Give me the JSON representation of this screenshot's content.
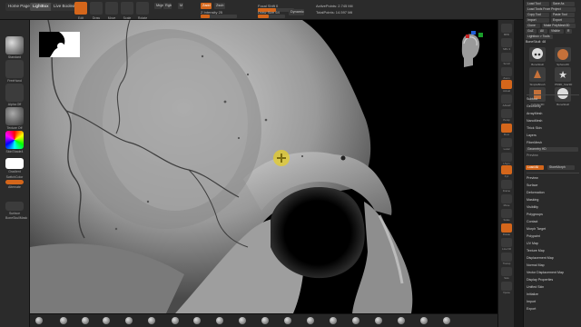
{
  "colors": {
    "accent": "#d4661b",
    "panel": "#2b2b2b",
    "viewport_bg": "#000000",
    "cursor": "#e6cd28"
  },
  "top_bar": {
    "tabs": [
      "Home Page",
      "LightBox",
      "Live Boolean"
    ],
    "tools": [
      {
        "label": "Edit",
        "icon": "edit-icon",
        "active": true
      },
      {
        "label": "Draw",
        "icon": "draw-icon"
      },
      {
        "label": "Move",
        "icon": "move-icon"
      },
      {
        "label": "Scale",
        "icon": "scale-icon"
      },
      {
        "label": "Rotate",
        "icon": "rotate-icon"
      }
    ],
    "brush_mode": {
      "mrgb": "Mrgb",
      "rgb": "Rgb",
      "m": "M"
    },
    "zadd": "Zadd",
    "zsub": "Zsub",
    "z_intensity": {
      "label": "Z Intensity",
      "value": 25
    },
    "focal_shift": {
      "label": "Focal Shift",
      "value": 0
    },
    "draw_size": {
      "label": "Draw Size",
      "value": 64
    },
    "dynamic": "Dynamic",
    "active_points": "ActivePoints: 2.745 Mil",
    "total_points": "TotalPoints: 14.597 Mil"
  },
  "left_shelf": {
    "items": [
      {
        "label": "Standard",
        "icon": "standard-brush-icon"
      },
      {
        "label": "FreeHand",
        "icon": "freehand-stroke-icon"
      },
      {
        "label": "Alpha Off",
        "icon": "alpha-off-icon"
      },
      {
        "label": "Texture Off",
        "icon": "texture-off-icon"
      },
      {
        "label": "SkinShade4",
        "icon": "material-sphere-icon"
      },
      {
        "label": "Gradient",
        "icon": "gradient-icon"
      },
      {
        "label": "SwitchColor",
        "icon": "switch-color-icon"
      },
      {
        "label": "Alternate",
        "icon": "alternate-icon"
      }
    ],
    "bottom_labels": [
      "Surface",
      "BoneSkullMask"
    ]
  },
  "right_strip": {
    "buttons": [
      {
        "label": "BPR",
        "icon": "bpr-icon"
      },
      {
        "label": "SPix 3",
        "icon": "spix-icon"
      },
      {
        "label": "Scroll",
        "icon": "scroll-icon"
      },
      {
        "label": "Zoom",
        "icon": "zoom-icon"
      },
      {
        "label": "Actual",
        "icon": "actual-icon"
      },
      {
        "label": "AAHalf",
        "icon": "aahalf-icon"
      },
      {
        "label": "Persp",
        "icon": "persp-icon",
        "active": true
      },
      {
        "label": "Floor",
        "icon": "floor-icon"
      },
      {
        "label": "Local",
        "icon": "local-icon"
      },
      {
        "label": "LSym",
        "icon": "lsym-icon"
      },
      {
        "label": "Xyz",
        "icon": "xyz-icon",
        "active": true
      },
      {
        "label": "Frame",
        "icon": "frame-icon"
      },
      {
        "label": "Move",
        "icon": "move-icon"
      },
      {
        "label": "Scale",
        "icon": "scale-icon"
      },
      {
        "label": "Rotate",
        "icon": "rotate-icon"
      },
      {
        "label": "Line Fill",
        "icon": "linefill-icon"
      },
      {
        "label": "Transp",
        "icon": "transp-icon"
      },
      {
        "label": "Solo",
        "icon": "solo-icon"
      },
      {
        "label": "Xpose",
        "icon": "xpose-icon"
      }
    ]
  },
  "tool_palette": {
    "top_buttons": [
      [
        "Load Tool",
        "Save As"
      ],
      [
        "Load Tools From Project"
      ],
      [
        "Copy Tool",
        "Paste Tool"
      ],
      [
        "Import",
        "Export"
      ],
      [
        "Clone",
        "Make PolyMesh3D"
      ],
      [
        "GoZ",
        "All",
        "Visible",
        "R"
      ],
      [
        "Lightbox > Tools"
      ]
    ],
    "current_tool": "BoneSkull: 48",
    "thumbnails": [
      {
        "label": "BoneSkull",
        "icon": "skull-thumb-icon"
      },
      {
        "label": "Sphere3D",
        "icon": "sphere-thumb-icon"
      },
      {
        "label": "SimpleBrush",
        "icon": "simplebrush-thumb-icon"
      },
      {
        "label": "PM3D_Star3D",
        "icon": "star-thumb-icon"
      },
      {
        "label": "Cylinder3D",
        "icon": "cylinder-thumb-icon"
      },
      {
        "label": "BoneSkull",
        "icon": "skull-thumb-icon"
      }
    ],
    "menu_top": [
      "Subtool",
      "Geometry",
      "ArrayMesh",
      "NanoMesh",
      "Thick Skin",
      "Layers",
      "FiberMesh"
    ],
    "geometry_hd": "Geometry HD",
    "preview": "Preview",
    "morph_buttons": [
      "Load All",
      "StoreMorph"
    ],
    "menu_bottom": [
      "Preview",
      "Surface",
      "Deformation",
      "Masking",
      "Visibility",
      "Polygroups",
      "Contact",
      "Morph Target",
      "Polypaint",
      "UV Map",
      "Texture Map",
      "Displacement Map",
      "Normal Map",
      "Vector Displacement Map",
      "Display Properties",
      "Unified Skin",
      "Initialize",
      "Import",
      "Export"
    ]
  },
  "bottom_shelf": {
    "brushes": [
      "standard-brush-icon",
      "clay-brush-icon",
      "claybuildup-brush-icon",
      "move-brush-icon",
      "damstandard-brush-icon",
      "inflate-brush-icon",
      "pinch-brush-icon",
      "trimdynamic-brush-icon",
      "hpolish-brush-icon",
      "smooth-brush-icon",
      "snakehook-brush-icon",
      "clip-brush-icon",
      "mask-brush-icon",
      "select-brush-icon",
      "slice-brush-icon",
      "trim-brush-icon",
      "curve-brush-icon",
      "zmodeler-brush-icon",
      "imm-brush-icon"
    ]
  }
}
